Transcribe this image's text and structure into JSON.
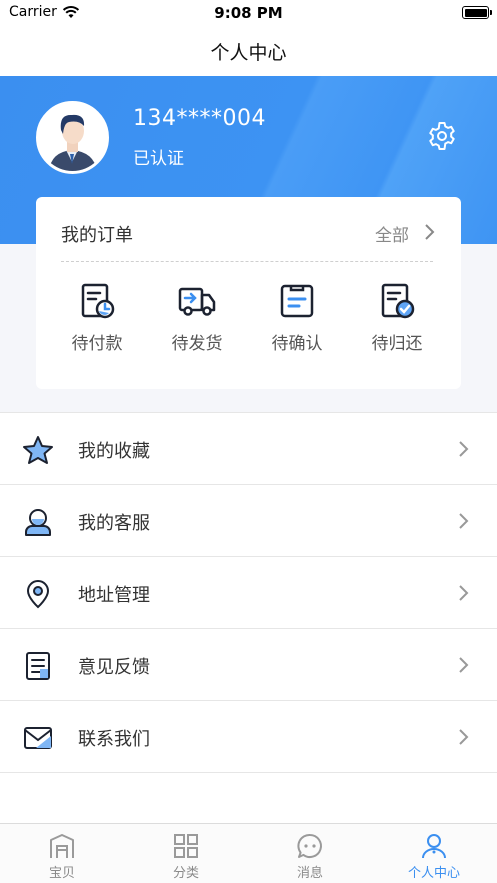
{
  "status_bar": {
    "carrier": "Carrier",
    "time": "9:08 PM"
  },
  "nav": {
    "title": "个人中心"
  },
  "profile": {
    "phone": "134****004",
    "status": "已认证"
  },
  "orders": {
    "title": "我的订单",
    "all_label": "全部",
    "items": [
      {
        "label": "待付款",
        "icon": "pending-payment-icon"
      },
      {
        "label": "待发货",
        "icon": "truck-icon"
      },
      {
        "label": "待确认",
        "icon": "clipboard-icon"
      },
      {
        "label": "待归还",
        "icon": "return-doc-icon"
      }
    ]
  },
  "menu": {
    "items": [
      {
        "label": "我的收藏",
        "icon": "star-icon"
      },
      {
        "label": "我的客服",
        "icon": "customer-service-icon"
      },
      {
        "label": "地址管理",
        "icon": "location-pin-icon"
      },
      {
        "label": "意见反馈",
        "icon": "feedback-icon"
      },
      {
        "label": "联系我们",
        "icon": "mail-icon"
      }
    ]
  },
  "tabs": [
    {
      "label": "宝贝",
      "icon": "home-icon",
      "active": false
    },
    {
      "label": "分类",
      "icon": "grid-icon",
      "active": false
    },
    {
      "label": "消息",
      "icon": "chat-icon",
      "active": false
    },
    {
      "label": "个人中心",
      "icon": "user-icon",
      "active": true
    }
  ],
  "colors": {
    "accent": "#3b8ff0",
    "text": "#333333",
    "muted": "#888888"
  }
}
